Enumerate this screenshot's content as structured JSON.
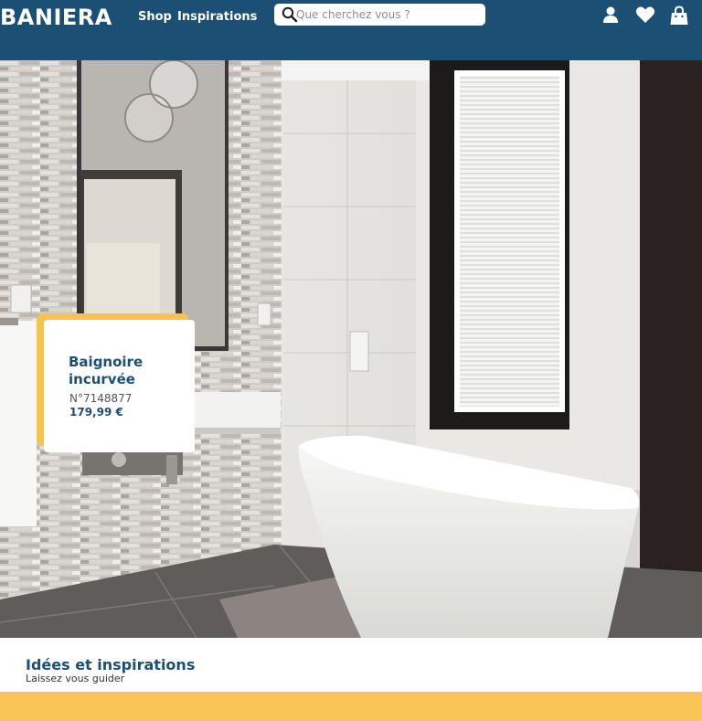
{
  "header": {
    "logo": "BANIERA",
    "nav": {
      "shop": "Shop",
      "inspirations": "Inspirations"
    },
    "search": {
      "placeholder": "Que cherchez vous ?"
    },
    "icons": [
      "user-icon",
      "heart-icon",
      "bag-icon"
    ],
    "background": "#1c4f74"
  },
  "product_card": {
    "title": "Baignoire incurvée",
    "reference": "N°7148877",
    "price": "179,99 €",
    "accent_color": "#f6c34c"
  },
  "section": {
    "title": "Idées et inspirations",
    "subtitle": "Laissez vous guider"
  },
  "colors": {
    "brand_blue": "#1c4f74",
    "accent_yellow": "#f9c557"
  }
}
